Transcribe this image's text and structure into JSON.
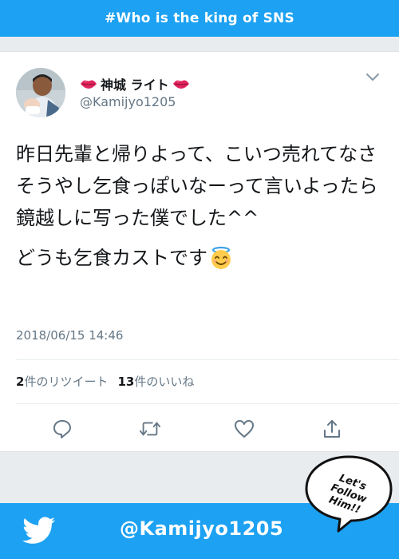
{
  "banner": {
    "hashtag": "#Who is the king of SNS"
  },
  "tweet": {
    "display_name": "神城 ライト",
    "handle": "@Kamijyo1205",
    "text_paragraph_1": "昨日先輩と帰りよって、こいつ売れてなさそうやし乞食っぽいなーって言いよったら鏡越しに写った僕でした^^",
    "text_paragraph_2": "どうも乞食カストです",
    "timestamp": "2018/06/15 14:46",
    "retweets_count": "2",
    "retweets_label": "件のリツイート",
    "likes_count": "13",
    "likes_label": "件のいいね"
  },
  "icons": {
    "name_decoration": "lips-icon",
    "menu": "chevron-down-icon",
    "emoji": "smiling-angel-face-icon",
    "reply": "reply-icon",
    "retweet": "retweet-icon",
    "like": "heart-icon",
    "share": "share-icon",
    "brand": "twitter-bird-icon"
  },
  "footer": {
    "handle": "@Kamijyo1205",
    "bubble_lines": [
      "Let's",
      "Follow",
      "Him!!"
    ]
  },
  "colors": {
    "brand_blue": "#1da1f2",
    "text": "#14171a",
    "secondary_text": "#657786",
    "lips_red": "#e0245e",
    "background_gray": "#e9ecef"
  }
}
